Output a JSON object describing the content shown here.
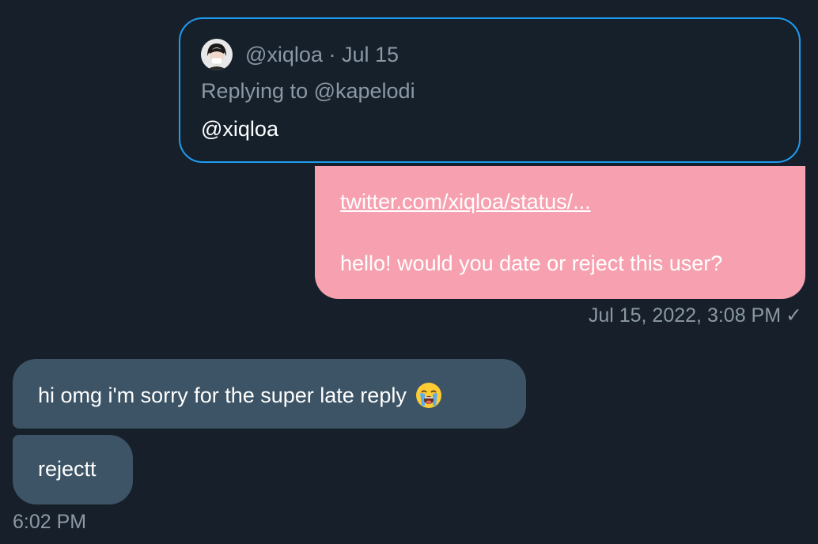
{
  "quoted_tweet": {
    "author_handle": "@xiqloa",
    "separator": "·",
    "date": "Jul 15",
    "replying_to": "Replying to @kapelodi",
    "text": "@xiqloa",
    "avatar_icon": "user-avatar-icon"
  },
  "sent_message": {
    "link": "twitter.com/xiqloa/status/...",
    "text": "hello! would you date or reject this user?",
    "timestamp": "Jul 15, 2022, 3:08 PM",
    "status_icon": "checkmark-icon",
    "status_glyph": "✓",
    "bubble_color": "#f7a1b0"
  },
  "received_messages": [
    {
      "text": "hi omg i'm sorry for the super late reply",
      "emoji_icon": "loudly-crying-face-icon"
    },
    {
      "text": "rejectt"
    }
  ],
  "received_time": "6:02 PM",
  "colors": {
    "background": "#17202a",
    "received_bubble": "#3d5466",
    "quote_border": "#1d9bf0",
    "muted_text": "#8b98a5"
  }
}
